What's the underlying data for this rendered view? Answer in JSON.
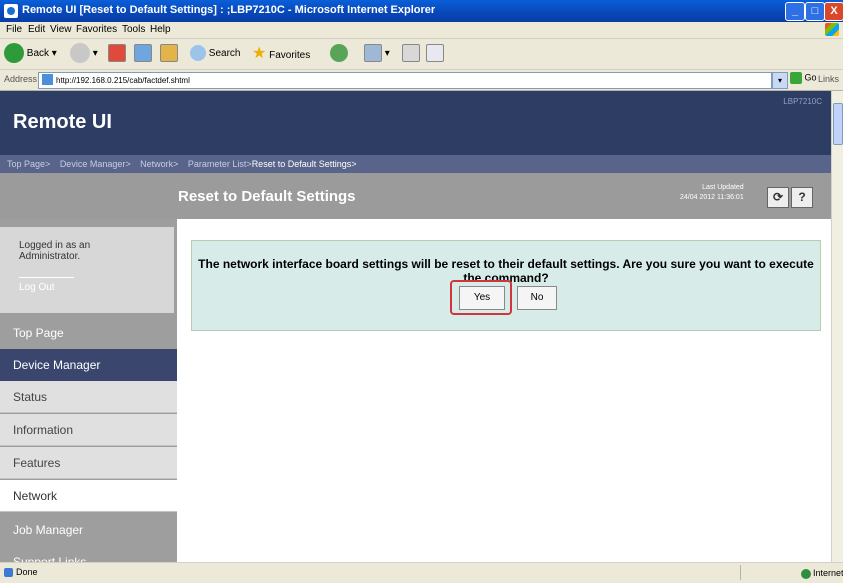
{
  "window": {
    "title": "Remote UI [Reset to Default Settings] : ;LBP7210C - Microsoft Internet Explorer",
    "minimize": "_",
    "maximize": "□",
    "close": "X"
  },
  "menu": {
    "items": [
      "File",
      "Edit",
      "View",
      "Favorites",
      "Tools",
      "Help"
    ]
  },
  "toolbar": {
    "back_label": "Back",
    "search_label": "Search",
    "favorites_label": "Favorites"
  },
  "address": {
    "label": "Address",
    "url": "http://192.168.0.215/cab/factdef.shtml",
    "go_label": "Go",
    "links_label": "Links"
  },
  "header": {
    "brand": "Remote UI",
    "model": "LBP7210C"
  },
  "breadcrumb": {
    "items": [
      "Top Page>",
      "Device Manager>",
      "Network>",
      "Parameter List>"
    ],
    "current": "Reset to Default Settings>"
  },
  "titlebar": {
    "page_title": "Reset to Default Settings",
    "last_updated_label": "Last Updated",
    "last_updated_value": "24/04 2012 11:36:01",
    "refresh_icon": "refresh-icon",
    "help_label": "?"
  },
  "sidebar": {
    "login_text": "Logged in as an Administrator.",
    "logout_label": "Log Out",
    "top_page": "Top Page",
    "device_manager": "Device Manager",
    "sub_items": [
      "Status",
      "Information",
      "Features",
      "Network"
    ],
    "job_manager": "Job Manager",
    "support_links": "Support Links"
  },
  "dialog": {
    "message": "The network interface board settings will be reset to their default settings. Are you sure you want to execute the command?",
    "yes_label": "Yes",
    "no_label": "No",
    "highlight_color": "#d2343e"
  },
  "statusbar": {
    "status": "Done",
    "zone": "Internet"
  }
}
